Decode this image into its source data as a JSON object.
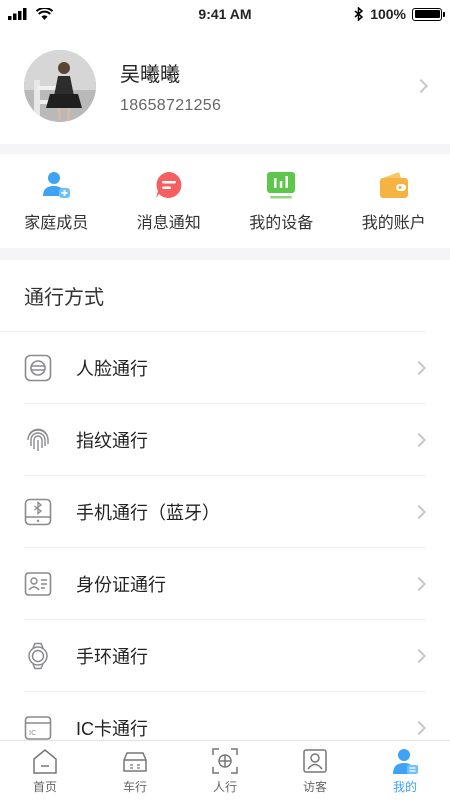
{
  "status_bar": {
    "time": "9:41 AM",
    "battery": "100%",
    "battery_level": 1.0
  },
  "profile": {
    "name": "吴曦曦",
    "phone": "18658721256"
  },
  "shortcuts": [
    {
      "label": "家庭成员",
      "icon": "family-member-icon",
      "color": "#3ea2f5"
    },
    {
      "label": "消息通知",
      "icon": "message-icon",
      "color": "#f55f5f"
    },
    {
      "label": "我的设备",
      "icon": "device-icon",
      "color": "#5cc74a"
    },
    {
      "label": "我的账户",
      "icon": "wallet-icon",
      "color": "#f5b342"
    }
  ],
  "pass_section": {
    "title": "通行方式",
    "items": [
      {
        "label": "人脸通行",
        "icon": "face-icon"
      },
      {
        "label": "指纹通行",
        "icon": "fingerprint-icon"
      },
      {
        "label": "手机通行（蓝牙）",
        "icon": "bluetooth-phone-icon"
      },
      {
        "label": "身份证通行",
        "icon": "id-card-icon"
      },
      {
        "label": "手环通行",
        "icon": "wristband-icon"
      },
      {
        "label": "IC卡通行",
        "icon": "ic-card-icon"
      }
    ]
  },
  "tabbar": {
    "items": [
      {
        "label": "首页",
        "icon": "home-icon",
        "active": false
      },
      {
        "label": "车行",
        "icon": "car-icon",
        "active": false
      },
      {
        "label": "人行",
        "icon": "face-scan-icon",
        "active": false
      },
      {
        "label": "访客",
        "icon": "visitor-icon",
        "active": false
      },
      {
        "label": "我的",
        "icon": "profile-icon",
        "active": true
      }
    ],
    "active_color": "#3ea2f5"
  }
}
